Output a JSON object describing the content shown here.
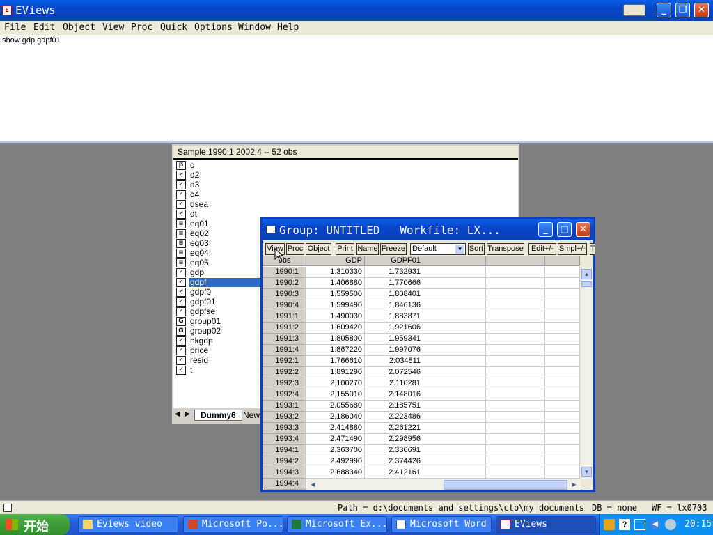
{
  "app": {
    "title": "EViews"
  },
  "menu": [
    "File",
    "Edit",
    "Object",
    "View",
    "Proc",
    "Quick",
    "Options",
    "Window",
    "Help"
  ],
  "command": "show gdp gdpf01",
  "workfile": {
    "sample": "Sample:1990:1 2002:4  --  52 obs",
    "objects": [
      {
        "name": "c",
        "type": "coef"
      },
      {
        "name": "d2",
        "type": "series"
      },
      {
        "name": "d3",
        "type": "series"
      },
      {
        "name": "d4",
        "type": "series"
      },
      {
        "name": "dsea",
        "type": "series"
      },
      {
        "name": "dt",
        "type": "series"
      },
      {
        "name": "eq01",
        "type": "equation"
      },
      {
        "name": "eq02",
        "type": "equation"
      },
      {
        "name": "eq03",
        "type": "equation"
      },
      {
        "name": "eq04",
        "type": "equation"
      },
      {
        "name": "eq05",
        "type": "equation"
      },
      {
        "name": "gdp",
        "type": "series"
      },
      {
        "name": "gdpf",
        "type": "series",
        "selected": true
      },
      {
        "name": "gdpf0",
        "type": "series"
      },
      {
        "name": "gdpf01",
        "type": "series"
      },
      {
        "name": "gdpfse",
        "type": "series"
      },
      {
        "name": "group01",
        "type": "group"
      },
      {
        "name": "group02",
        "type": "group"
      },
      {
        "name": "hkgdp",
        "type": "series"
      },
      {
        "name": "price",
        "type": "series"
      },
      {
        "name": "resid",
        "type": "series"
      },
      {
        "name": "t",
        "type": "series"
      }
    ],
    "tabs": [
      "Dummy6",
      "New"
    ]
  },
  "group": {
    "title": "Group: UNTITLED   Workfile: LX...",
    "toolbar": [
      "View",
      "Proc",
      "Object",
      "Print",
      "Name",
      "Freeze",
      "Default",
      "Sort",
      "Transpose",
      "Edit+/-",
      "Smpl+/-",
      "T"
    ],
    "columns": [
      "obs",
      "GDP",
      "GDPF01"
    ],
    "rows": [
      [
        "1990:1",
        "1.310330",
        "1.732931"
      ],
      [
        "1990:2",
        "1.406880",
        "1.770666"
      ],
      [
        "1990:3",
        "1.559500",
        "1.808401"
      ],
      [
        "1990:4",
        "1.599490",
        "1.846136"
      ],
      [
        "1991:1",
        "1.490030",
        "1.883871"
      ],
      [
        "1991:2",
        "1.609420",
        "1.921606"
      ],
      [
        "1991:3",
        "1.805800",
        "1.959341"
      ],
      [
        "1991:4",
        "1.867220",
        "1.997076"
      ],
      [
        "1992:1",
        "1.766610",
        "2.034811"
      ],
      [
        "1992:2",
        "1.891290",
        "2.072546"
      ],
      [
        "1992:3",
        "2.100270",
        "2.110281"
      ],
      [
        "1992:4",
        "2.155010",
        "2.148016"
      ],
      [
        "1993:1",
        "2.055680",
        "2.185751"
      ],
      [
        "1993:2",
        "2.186040",
        "2.223486"
      ],
      [
        "1993:3",
        "2.414880",
        "2.261221"
      ],
      [
        "1993:4",
        "2.471490",
        "2.298956"
      ],
      [
        "1994:1",
        "2.363700",
        "2.336691"
      ],
      [
        "1994:2",
        "2.492990",
        "2.374426"
      ],
      [
        "1994:3",
        "2.688340",
        "2.412161"
      ],
      [
        "1994:4",
        "",
        ""
      ]
    ]
  },
  "status": {
    "path": "Path = d:\\documents and settings\\ctb\\my documents",
    "db": "DB = none",
    "wf": "WF = lx0703"
  },
  "taskbar": {
    "start": "开始",
    "tasks": [
      "Eviews video",
      "Microsoft Po...",
      "Microsoft Ex...",
      "Microsoft Word",
      "EViews"
    ],
    "clock": "20:15"
  }
}
